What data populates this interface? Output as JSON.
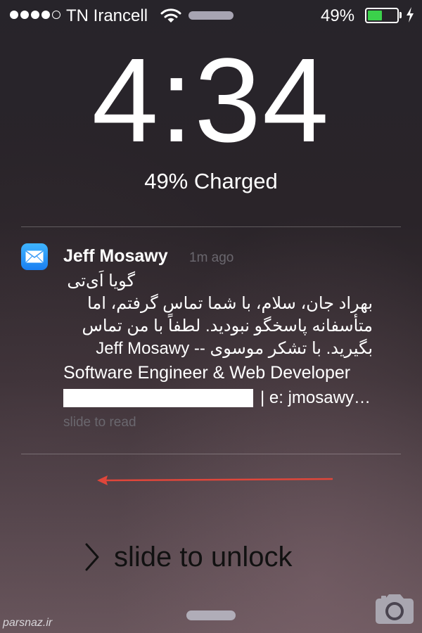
{
  "status_bar": {
    "signal_bars_filled": 4,
    "signal_bars_total": 5,
    "carrier": "TN Irancell",
    "battery_percent_label": "49%",
    "battery_level": 0.49,
    "battery_color": "#3bd14b",
    "wifi_icon": "wifi-icon",
    "charging_icon": "bolt-icon"
  },
  "lock_screen": {
    "time": "4:34",
    "charge_status": "49% Charged"
  },
  "notification": {
    "app_icon": "mail-icon",
    "sender": "Jeff Mosawy",
    "time_ago": "1m ago",
    "subject": "گویا اَی‌تی",
    "body_lines": [
      "بهراد جان، سلام، با شما تماس گرفتم، اما",
      "متأسفانه پاسخگو نبودید. لطفاً با من تماس",
      "بگیرید. با تشکر موسوی -- Jeff Mosawy",
      "Software Engineer & Web Developer"
    ],
    "email_fragment": "| e: jmosawy…",
    "hint": "slide to read"
  },
  "unlock": {
    "label": "slide to unlock",
    "camera_icon": "camera-icon"
  },
  "annotation": {
    "arrow_color": "#e0463a"
  },
  "watermark": "parsnaz.ir"
}
